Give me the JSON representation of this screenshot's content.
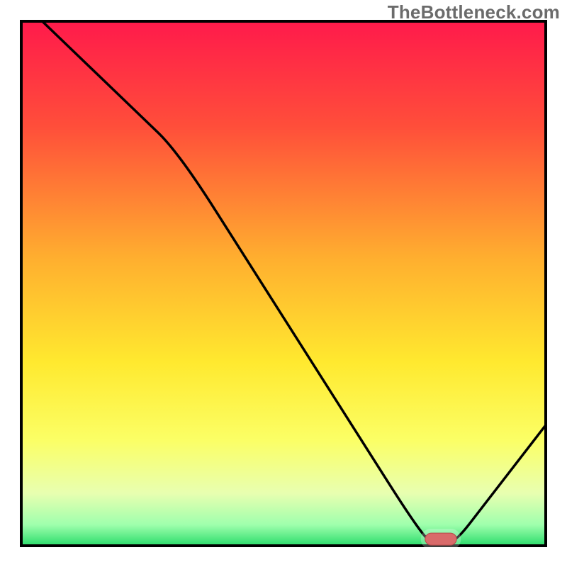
{
  "watermark": "TheBottleneck.com",
  "chart_data": {
    "type": "line",
    "title": "",
    "xlabel": "",
    "ylabel": "",
    "xlim": [
      0,
      100
    ],
    "ylim": [
      0,
      100
    ],
    "series": [
      {
        "name": "curve",
        "x": [
          4,
          30,
          77,
          83,
          100
        ],
        "y": [
          100,
          75,
          1,
          1,
          23
        ]
      }
    ],
    "marker": {
      "x_start": 77,
      "x_end": 83,
      "y": 1
    },
    "gradient_stops": [
      {
        "offset": 0,
        "color": "#ff1a4b"
      },
      {
        "offset": 20,
        "color": "#ff4e3a"
      },
      {
        "offset": 45,
        "color": "#ffae2f"
      },
      {
        "offset": 65,
        "color": "#ffe92f"
      },
      {
        "offset": 80,
        "color": "#fbff66"
      },
      {
        "offset": 90,
        "color": "#e8ffb0"
      },
      {
        "offset": 96,
        "color": "#9fffad"
      },
      {
        "offset": 100,
        "color": "#2bdc6b"
      }
    ],
    "border_color": "#000000",
    "marker_fill": "#d96a6a",
    "marker_stroke": "#b54848"
  }
}
